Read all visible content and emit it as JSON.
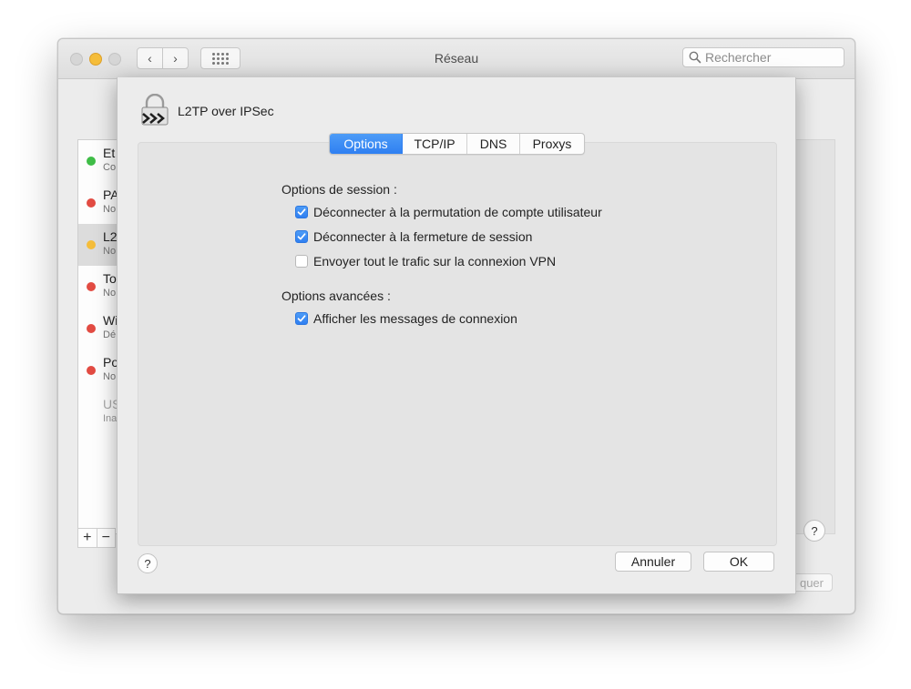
{
  "window": {
    "title": "Réseau",
    "search_placeholder": "Rechercher",
    "nav_back": "‹",
    "nav_forward": "›"
  },
  "sidebar": {
    "items": [
      {
        "name": "Et",
        "sub": "Co",
        "status_color": "#3fbd47"
      },
      {
        "name": "PA",
        "sub": "No",
        "status_color": "#e24b42"
      },
      {
        "name": "L2",
        "sub": "No",
        "status_color": "#f5bd3a"
      },
      {
        "name": "To",
        "sub": "No",
        "status_color": "#e24b42"
      },
      {
        "name": "Wi",
        "sub": "Dé",
        "status_color": "#e24b42"
      },
      {
        "name": "Po",
        "sub": "No",
        "status_color": "#e24b42"
      },
      {
        "name": "US",
        "sub": "Ina",
        "status_color": ""
      }
    ],
    "add_label": "+",
    "remove_label": "−"
  },
  "main": {
    "help_label": "?",
    "apply_label": "quer"
  },
  "sheet": {
    "title": "L2TP over IPSec",
    "tabs": [
      {
        "label": "Options",
        "active": true
      },
      {
        "label": "TCP/IP",
        "active": false
      },
      {
        "label": "DNS",
        "active": false
      },
      {
        "label": "Proxys",
        "active": false
      }
    ],
    "session_label": "Options de session :",
    "session_options": [
      {
        "label": "Déconnecter à la permutation de compte utilisateur",
        "checked": true
      },
      {
        "label": "Déconnecter à la fermeture de session",
        "checked": true
      },
      {
        "label": "Envoyer tout le trafic sur la connexion VPN",
        "checked": false
      }
    ],
    "advanced_label": "Options avancées :",
    "advanced_options": [
      {
        "label": "Afficher les messages de connexion",
        "checked": true
      }
    ],
    "help_label": "?",
    "cancel_label": "Annuler",
    "ok_label": "OK"
  },
  "colors": {
    "accent": "#2f7ff1",
    "status_green": "#3fbd47",
    "status_red": "#e24b42",
    "status_yellow": "#f5bd3a"
  }
}
